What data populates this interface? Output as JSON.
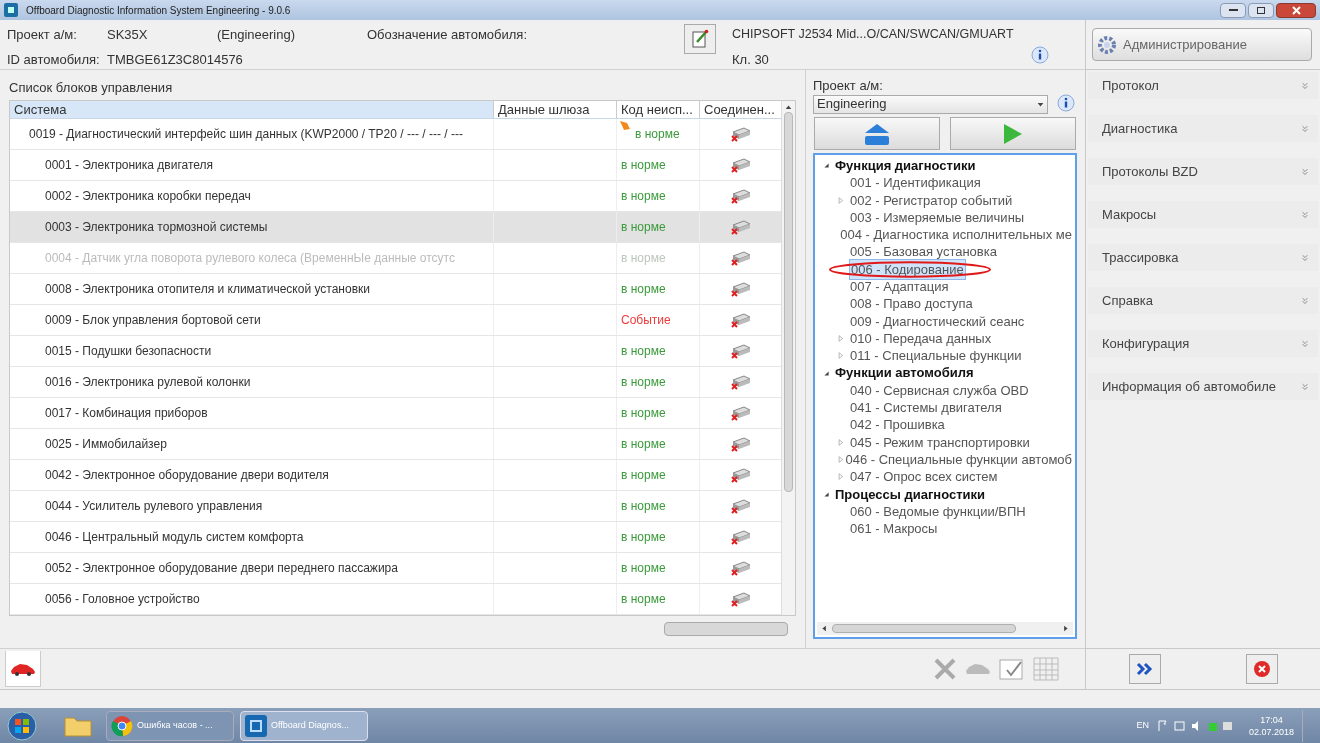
{
  "window": {
    "title": "Offboard Diagnostic Information System Engineering - 9.0.6"
  },
  "header": {
    "project_label": "Проект а/м:",
    "project_value": "SK35X",
    "project_mode": "(Engineering)",
    "vehicle_label": "Обозначение автомобиля:",
    "id_label": "ID автомобиля:",
    "id_value": "TMBGE61Z3C8014576",
    "interface": "CHIPSOFT J2534 Mid...O/CAN/SWCAN/GMUART",
    "terminal": "Кл. 30"
  },
  "control_units": {
    "title": "Список блоков управления",
    "columns": [
      "Система",
      "Данные шлюза",
      "Код неисп...",
      "Соединен..."
    ],
    "rows": [
      {
        "name": "0019 - Диагностический интерфейс шин данных  (KWP2000 / TP20 / --- / --- / ---",
        "status": "в норме",
        "kind": "ok",
        "disabled": false,
        "selected": false,
        "flagged": true,
        "children": [
          {
            "name": "0001 - Электроника двигателя",
            "status": "в норме",
            "kind": "ok",
            "disabled": false,
            "selected": false,
            "flagged": false
          },
          {
            "name": "0002 - Электроника коробки передач",
            "status": "в норме",
            "kind": "ok",
            "disabled": false,
            "selected": false,
            "flagged": false
          },
          {
            "name": "0003 - Электроника тормозной системы",
            "status": "в норме",
            "kind": "ok",
            "disabled": false,
            "selected": true,
            "flagged": false
          },
          {
            "name": "0004 - Датчик угла поворота рулевого колеса  (ВременнЫе данные отсутс",
            "status": "в норме",
            "kind": "ok",
            "disabled": true,
            "selected": false,
            "flagged": false
          },
          {
            "name": "0008 - Электроника отопителя и климатической установки",
            "status": "в норме",
            "kind": "ok",
            "disabled": false,
            "selected": false,
            "flagged": false
          },
          {
            "name": "0009 - Блок управления бортовой сети",
            "status": "Событие",
            "kind": "event",
            "disabled": false,
            "selected": false,
            "flagged": false
          },
          {
            "name": "0015 - Подушки безопасности",
            "status": "в норме",
            "kind": "ok",
            "disabled": false,
            "selected": false,
            "flagged": false
          },
          {
            "name": "0016 - Электроника рулевой колонки",
            "status": "в норме",
            "kind": "ok",
            "disabled": false,
            "selected": false,
            "flagged": false
          },
          {
            "name": "0017 - Комбинация приборов",
            "status": "в норме",
            "kind": "ok",
            "disabled": false,
            "selected": false,
            "flagged": false
          },
          {
            "name": "0025 - Иммобилайзер",
            "status": "в норме",
            "kind": "ok",
            "disabled": false,
            "selected": false,
            "flagged": false
          },
          {
            "name": "0042 - Электронное оборудование двери водителя",
            "status": "в норме",
            "kind": "ok",
            "disabled": false,
            "selected": false,
            "flagged": false
          },
          {
            "name": "0044 - Усилитель рулевого управления",
            "status": "в норме",
            "kind": "ok",
            "disabled": false,
            "selected": false,
            "flagged": false
          },
          {
            "name": "0046 - Центральный модуль систем комфорта",
            "status": "в норме",
            "kind": "ok",
            "disabled": false,
            "selected": false,
            "flagged": false
          },
          {
            "name": "0052 - Электронное оборудование двери переднего пассажира",
            "status": "в норме",
            "kind": "ok",
            "disabled": false,
            "selected": false,
            "flagged": false
          },
          {
            "name": "0056 - Головное устройство",
            "status": "в норме",
            "kind": "ok",
            "disabled": false,
            "selected": false,
            "flagged": false
          }
        ]
      }
    ]
  },
  "functions": {
    "project_label": "Проект а/м:",
    "project_value": "Engineering",
    "tree": [
      {
        "label": "Функция диагностики",
        "expanded": true,
        "children": [
          {
            "label": "001 - Идентификация",
            "expandable": false,
            "selected": false,
            "circled": false
          },
          {
            "label": "002 - Регистратор событий",
            "expandable": true,
            "selected": false,
            "circled": false
          },
          {
            "label": "003 - Измеряемые величины",
            "expandable": false,
            "selected": false,
            "circled": false
          },
          {
            "label": "004 - Диагностика исполнительных ме",
            "expandable": false,
            "selected": false,
            "circled": false
          },
          {
            "label": "005 - Базовая установка",
            "expandable": false,
            "selected": false,
            "circled": false
          },
          {
            "label": "006 - Кодирование",
            "expandable": false,
            "selected": true,
            "circled": true
          },
          {
            "label": "007 - Адаптация",
            "expandable": false,
            "selected": false,
            "circled": false
          },
          {
            "label": "008 - Право доступа",
            "expandable": false,
            "selected": false,
            "circled": false
          },
          {
            "label": "009 - Диагностический сеанс",
            "expandable": false,
            "selected": false,
            "circled": false
          },
          {
            "label": "010 - Передача данных",
            "expandable": true,
            "selected": false,
            "circled": false
          },
          {
            "label": "011 - Специальные функции",
            "expandable": true,
            "selected": false,
            "circled": false
          }
        ]
      },
      {
        "label": "Функции автомобиля",
        "expanded": true,
        "children": [
          {
            "label": "040 - Сервисная служба OBD",
            "expandable": false,
            "selected": false,
            "circled": false
          },
          {
            "label": "041 - Системы двигателя",
            "expandable": false,
            "selected": false,
            "circled": false
          },
          {
            "label": "042 - Прошивка",
            "expandable": false,
            "selected": false,
            "circled": false
          },
          {
            "label": "045 - Режим транспортировки",
            "expandable": true,
            "selected": false,
            "circled": false
          },
          {
            "label": "046 - Специальные функции автомоб",
            "expandable": true,
            "selected": false,
            "circled": false
          },
          {
            "label": "047 - Опрос всех систем",
            "expandable": true,
            "selected": false,
            "circled": false
          }
        ]
      },
      {
        "label": "Процессы диагностики",
        "expanded": true,
        "children": [
          {
            "label": "060 - Ведомые функции/ВПН",
            "expandable": false,
            "selected": false,
            "circled": false
          },
          {
            "label": "061 - Макросы",
            "expandable": false,
            "selected": false,
            "circled": false
          }
        ]
      }
    ]
  },
  "sidebar": {
    "admin_button": "Администрирование",
    "items": [
      {
        "label": "Протокол"
      },
      {
        "label": "Диагностика"
      },
      {
        "label": "Протоколы BZD"
      },
      {
        "label": "Макросы"
      },
      {
        "label": "Трассировка"
      },
      {
        "label": "Справка"
      },
      {
        "label": "Конфигурация"
      },
      {
        "label": "Информация об автомобиле"
      }
    ]
  },
  "taskbar": {
    "tasks": [
      {
        "label": "Ошибка часов - ...",
        "kind": "browser",
        "selected": false
      },
      {
        "label": "Offboard Diagnos...",
        "kind": "odis",
        "selected": true
      }
    ],
    "language": "EN",
    "time": "17:04",
    "date": "02.07.2018"
  }
}
